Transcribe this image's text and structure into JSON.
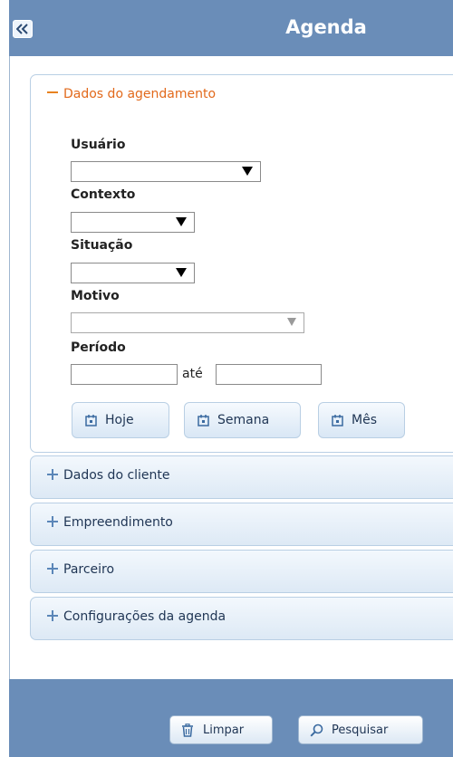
{
  "header": {
    "title": "Agenda",
    "collapse_icon": "double-chevron-left-icon"
  },
  "sections": {
    "agendamento": {
      "title": "Dados do agendamento",
      "fields": {
        "usuario": {
          "label": "Usuário",
          "value": ""
        },
        "contexto": {
          "label": "Contexto",
          "value": ""
        },
        "situacao": {
          "label": "Situação",
          "value": ""
        },
        "motivo": {
          "label": "Motivo",
          "value": ""
        },
        "periodo": {
          "label": "Período",
          "from": "",
          "to": "",
          "separator": "até"
        }
      },
      "buttons": {
        "hoje": "Hoje",
        "semana": "Semana",
        "mes": "Mês"
      }
    },
    "cliente": {
      "title": "Dados do cliente"
    },
    "empreendimento": {
      "title": "Empreendimento"
    },
    "parceiro": {
      "title": "Parceiro"
    },
    "configuracoes": {
      "title": "Configurações da agenda"
    }
  },
  "footer": {
    "limpar": "Limpar",
    "pesquisar": "Pesquisar"
  },
  "colors": {
    "header_bg": "#6a8db8",
    "section_open_title": "#e2691b",
    "text_dark": "#1f3554"
  }
}
